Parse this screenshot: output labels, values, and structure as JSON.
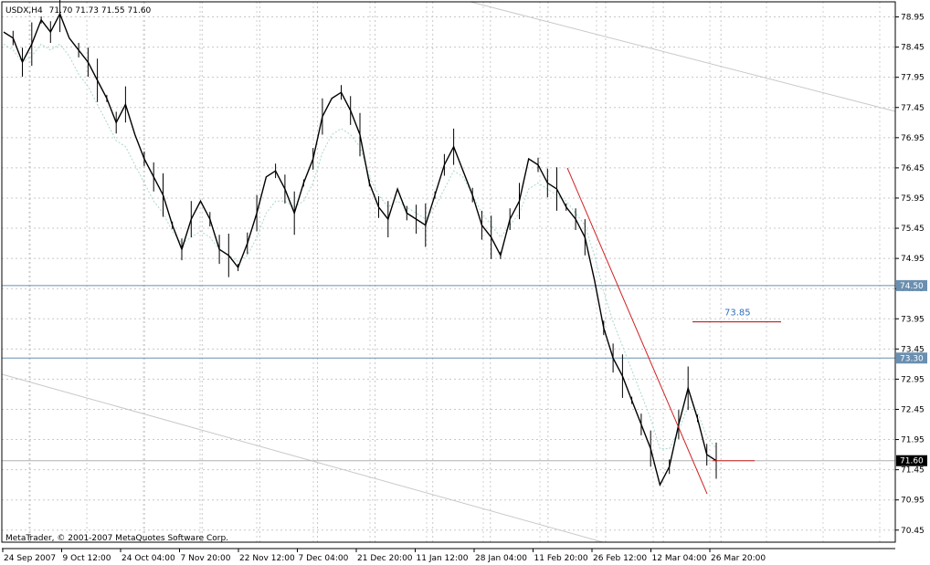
{
  "header": {
    "symbol": "USDX,H4",
    "ohlc": "71.70 71.73 71.55 71.60"
  },
  "copyright": "MetaTrader, © 2001-2007 MetaQuotes Software Corp.",
  "chart_data": {
    "type": "line",
    "title": "USDX,H4  71.70 71.73 71.55 71.60",
    "ylim": [
      70.25,
      79.2
    ],
    "y_ticks": [
      "78.95",
      "78.45",
      "77.95",
      "77.45",
      "76.95",
      "76.45",
      "75.95",
      "75.45",
      "74.95",
      "74.45",
      "73.95",
      "73.45",
      "72.95",
      "72.45",
      "71.95",
      "71.45",
      "70.95",
      "70.45"
    ],
    "x_ticks": [
      "24 Sep 2007",
      "9 Oct 12:00",
      "24 Oct 04:00",
      "7 Nov 20:00",
      "22 Nov 12:00",
      "7 Dec 04:00",
      "21 Dec 20:00",
      "11 Jan 12:00",
      "28 Jan 04:00",
      "11 Feb 20:00",
      "26 Feb 12:00",
      "12 Mar 04:00",
      "26 Mar 20:00"
    ],
    "grid": true,
    "series": [
      {
        "values": [
          78.7,
          78.6,
          78.2,
          78.5,
          78.9,
          78.7,
          79.0,
          78.6,
          78.4,
          78.2,
          77.9,
          77.6,
          77.2,
          77.5,
          77.0,
          76.6,
          76.3,
          76.0,
          75.5,
          75.1,
          75.6,
          75.9,
          75.6,
          75.1,
          75.0,
          74.8,
          75.2,
          75.7,
          76.3,
          76.4,
          76.1,
          75.7,
          76.2,
          76.6,
          77.3,
          77.6,
          77.7,
          77.4,
          77.0,
          76.2,
          75.8,
          75.6,
          76.1,
          75.7,
          75.6,
          75.5,
          76.0,
          76.5,
          76.8,
          76.4,
          76.0,
          75.5,
          75.3,
          75.0,
          75.6,
          75.9,
          76.6,
          76.5,
          76.2,
          76.1,
          75.8,
          75.6,
          75.3,
          74.6,
          73.8,
          73.3,
          73.0,
          72.6,
          72.2,
          71.8,
          71.2,
          71.5,
          72.2,
          72.8,
          72.3,
          71.7,
          71.6
        ],
        "color": "#000000"
      },
      {
        "values": [
          78.5,
          78.4,
          78.2,
          78.3,
          78.5,
          78.4,
          78.5,
          78.3,
          78.0,
          77.8,
          77.5,
          77.2,
          76.9,
          76.8,
          76.5,
          76.2,
          75.9,
          75.7,
          75.4,
          75.2,
          75.3,
          75.4,
          75.3,
          75.1,
          75.0,
          74.9,
          75.0,
          75.3,
          75.7,
          75.9,
          75.9,
          75.8,
          75.9,
          76.2,
          76.7,
          77.0,
          77.1,
          77.0,
          76.8,
          76.3,
          76.0,
          75.8,
          75.9,
          75.8,
          75.7,
          75.6,
          75.8,
          76.1,
          76.4,
          76.3,
          76.0,
          75.7,
          75.5,
          75.3,
          75.5,
          75.7,
          76.1,
          76.2,
          76.1,
          76.0,
          75.9,
          75.7,
          75.5,
          75.0,
          74.4,
          73.9,
          73.5,
          73.1,
          72.7,
          72.3,
          71.8,
          71.8,
          72.1,
          72.5,
          72.4,
          72.0,
          71.8
        ],
        "color": "#a8d8d0"
      }
    ],
    "levels": [
      {
        "value": 74.5,
        "label": "74.50",
        "color": "#6a8fb0"
      },
      {
        "value": 73.3,
        "label": "73.30",
        "color": "#6a8fb0"
      },
      {
        "value": 71.6,
        "label": "71.60",
        "color": "#000000"
      }
    ],
    "annotations": [
      {
        "text": "73.85",
        "value": 73.9,
        "color": "#c00000"
      }
    ]
  }
}
